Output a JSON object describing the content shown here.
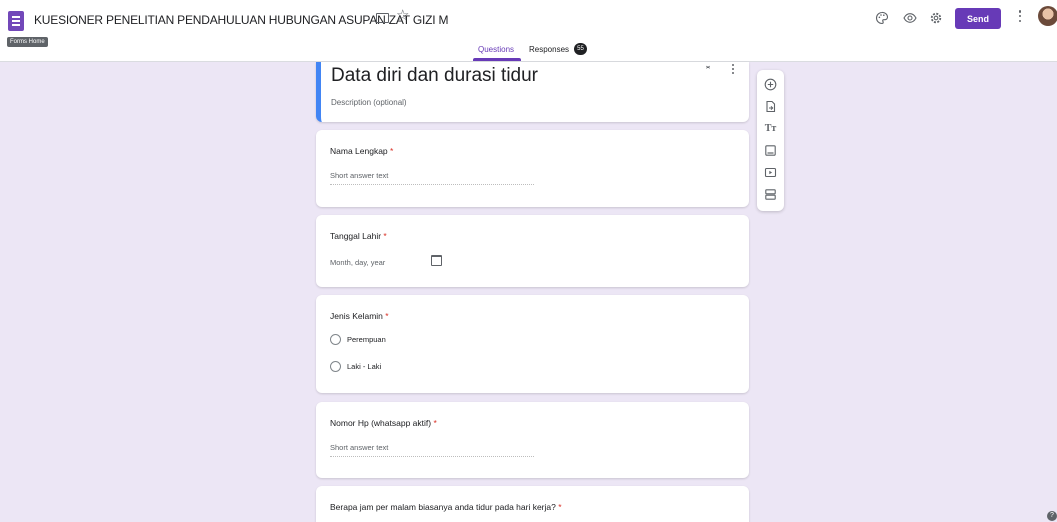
{
  "header": {
    "title": "KUESIONER PENELITIAN PENDAHULUAN HUBUNGAN ASUPAN ZAT GIZI M",
    "tooltip": "Forms Home",
    "send_label": "Send"
  },
  "tabs": [
    {
      "label": "Questions",
      "active": true
    },
    {
      "label": "Responses",
      "active": false,
      "count": "55"
    }
  ],
  "section": {
    "title": "Data diri dan durasi tidur",
    "description_placeholder": "Description (optional)"
  },
  "questions": [
    {
      "label": "Nama Lengkap",
      "required": "*",
      "type": "short",
      "placeholder": "Short answer text"
    },
    {
      "label": "Tanggal Lahir",
      "required": "*",
      "type": "date",
      "placeholder": "Month, day, year"
    },
    {
      "label": "Jenis Kelamin",
      "required": "*",
      "type": "radio",
      "options": [
        "Perempuan",
        "Laki - Laki"
      ]
    },
    {
      "label": "Nomor Hp (whatsapp aktif)",
      "required": "*",
      "type": "short",
      "placeholder": "Short answer text"
    },
    {
      "label": "Berapa jam per malam biasanya anda tidur pada hari kerja?",
      "required": "*",
      "type": "other"
    }
  ],
  "icons": {
    "top": [
      "palette-icon",
      "preview-eye-icon",
      "settings-gear-icon",
      "more-vert-icon",
      "account-avatar"
    ],
    "side_toolbar": [
      "add-question-icon",
      "import-questions-icon",
      "add-title-icon",
      "add-image-icon",
      "add-video-icon",
      "add-section-icon"
    ]
  },
  "colors": {
    "accent": "#673ab7",
    "page_background": "#ece6f5",
    "section_border": "#4285f4",
    "required": "#d93025"
  }
}
